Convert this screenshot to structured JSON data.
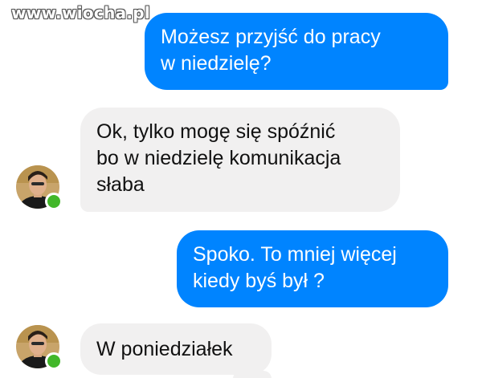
{
  "watermark": "www.wiocha.pl",
  "messages": [
    {
      "direction": "sent",
      "text": "Możesz przyjść do pracy\nw niedzielę?"
    },
    {
      "direction": "received",
      "text": "Ok, tylko mogę się spóźnić\nbo w niedzielę komunikacja\nsłaba"
    },
    {
      "direction": "sent",
      "text": "Spoko. To mniej więcej\nkiedy byś był ?"
    },
    {
      "direction": "received",
      "text": "W poniedziałek"
    }
  ],
  "colors": {
    "sent_bubble": "#0084ff",
    "received_bubble": "#f1f0f0",
    "online_indicator": "#42b72a"
  },
  "icons": {
    "avatar": "contact-avatar",
    "status": "online-status-dot"
  }
}
